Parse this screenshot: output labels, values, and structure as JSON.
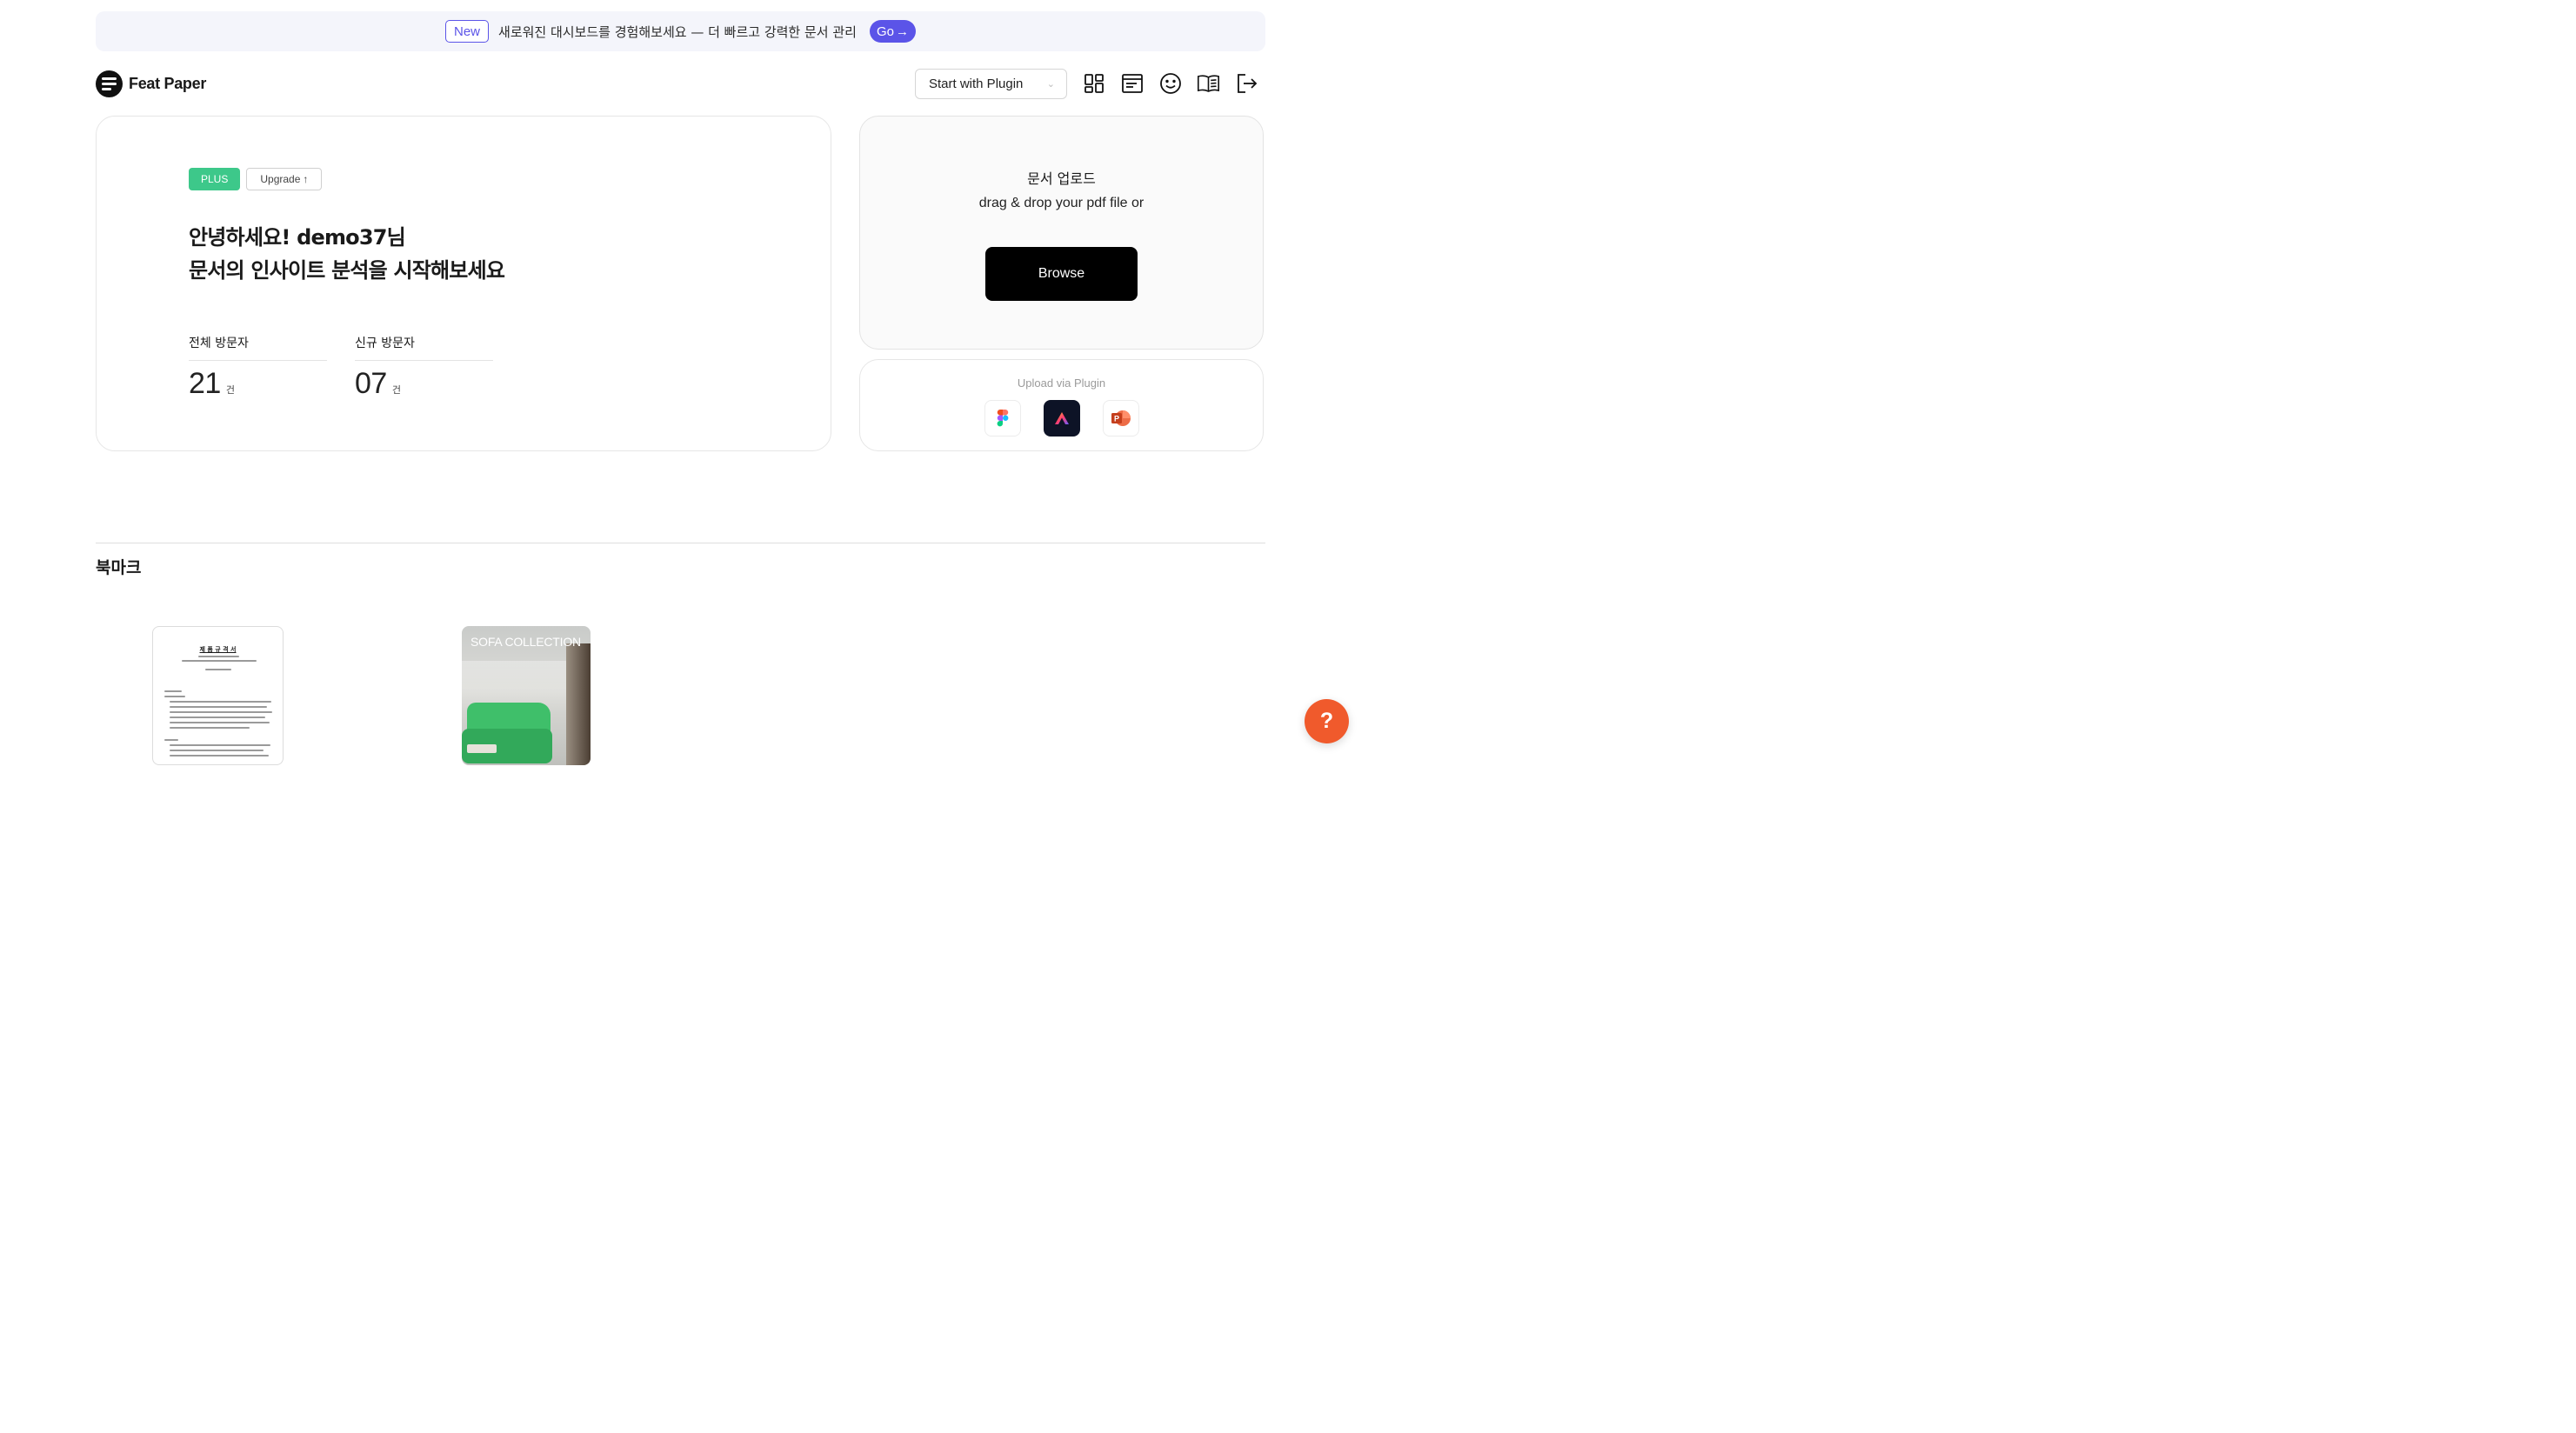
{
  "banner": {
    "new_label": "New",
    "message": "새로워진 대시보드를 경험해보세요 — 더 빠르고 강력한 문서 관리",
    "go_label": "Go",
    "accent": "#5b54e8"
  },
  "header": {
    "app_name": "Feat Paper",
    "plugin_select_value": "Start with Plugin",
    "icons": [
      "grid-icon",
      "browser-window-icon",
      "smile-icon",
      "book-icon",
      "logout-icon"
    ]
  },
  "welcome": {
    "plan_badge": "PLUS",
    "upgrade_label": "Upgrade",
    "greeting_line1": "안녕하세요! demo37님",
    "greeting_line2": "문서의 인사이트 분석을 시작해보세요",
    "stats": [
      {
        "label": "전체 방문자",
        "value": "21",
        "unit": "건"
      },
      {
        "label": "신규 방문자",
        "value": "07",
        "unit": "건"
      }
    ],
    "plan_color": "#3dc88a"
  },
  "upload": {
    "title": "문서 업로드",
    "subtitle": "drag & drop your pdf file or",
    "browse_label": "Browse"
  },
  "plugin": {
    "title": "Upload via Plugin",
    "items": [
      {
        "name": "figma-icon"
      },
      {
        "name": "adobe-acrobat-icon"
      },
      {
        "name": "powerpoint-icon"
      }
    ]
  },
  "bookmarks": {
    "title": "북마크",
    "items": [
      {
        "type": "document",
        "doc_title": "제 품 규 격 서"
      },
      {
        "type": "image",
        "caption": "SOFA COLLECTION"
      }
    ]
  },
  "help": {
    "label": "?",
    "color": "#f05a2c"
  }
}
